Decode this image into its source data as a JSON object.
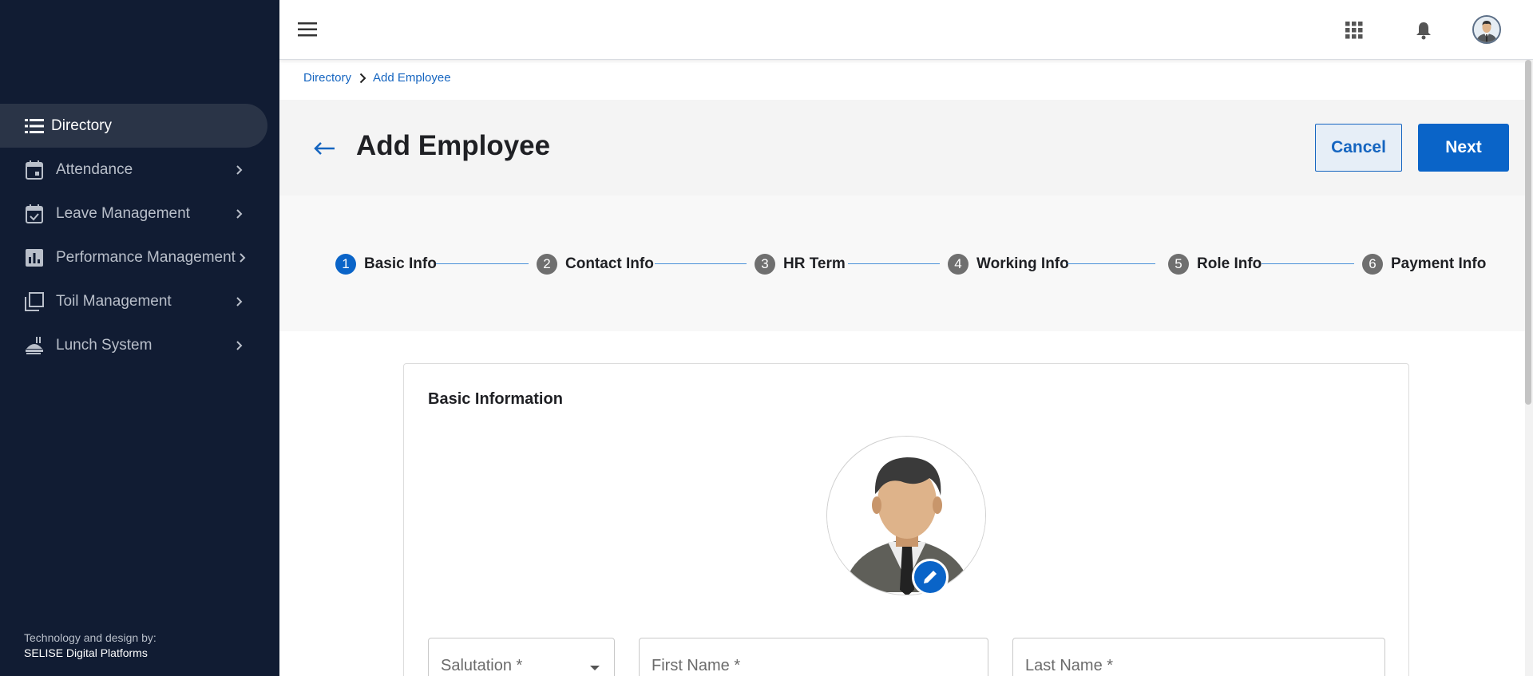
{
  "sidebar": {
    "items": [
      {
        "label": "Directory",
        "icon": "list-icon",
        "active": true
      },
      {
        "label": "Attendance",
        "icon": "calendar-icon"
      },
      {
        "label": "Leave Management",
        "icon": "calendar-check-icon"
      },
      {
        "label": "Performance Management",
        "icon": "bar-chart-icon"
      },
      {
        "label": "Toil Management",
        "icon": "stacked-squares-icon"
      },
      {
        "label": "Lunch System",
        "icon": "food-service-icon"
      }
    ],
    "footer": {
      "line1": "Technology and design by:",
      "line2": "SELISE Digital Platforms"
    }
  },
  "breadcrumb": {
    "items": [
      "Directory",
      "Add Employee"
    ]
  },
  "page": {
    "title": "Add Employee",
    "cancel_label": "Cancel",
    "next_label": "Next"
  },
  "stepper": {
    "steps": [
      {
        "number": "1",
        "label": "Basic Info",
        "active": true
      },
      {
        "number": "2",
        "label": "Contact Info"
      },
      {
        "number": "3",
        "label": "HR Term"
      },
      {
        "number": "4",
        "label": "Working Info"
      },
      {
        "number": "5",
        "label": "Role Info"
      },
      {
        "number": "6",
        "label": "Payment Info"
      }
    ]
  },
  "form": {
    "section_title": "Basic Information",
    "salutation_placeholder": "Salutation *",
    "first_name_placeholder": "First Name *",
    "last_name_placeholder": "Last Name *"
  },
  "colors": {
    "sidebar_bg": "#111c33",
    "primary": "#0a64c8",
    "link": "#1565c0"
  }
}
